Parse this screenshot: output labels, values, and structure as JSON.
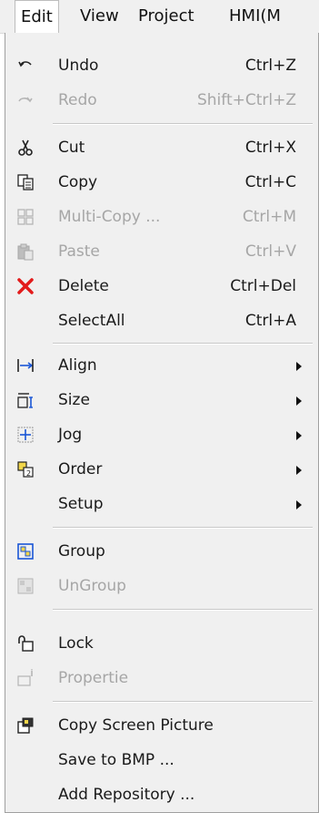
{
  "menubar": {
    "items": [
      "Edit",
      "View",
      "Project",
      "HMI(M"
    ]
  },
  "menu": {
    "undo": {
      "label": "Undo",
      "shortcut": "Ctrl+Z"
    },
    "redo": {
      "label": "Redo",
      "shortcut": "Shift+Ctrl+Z"
    },
    "cut": {
      "label": "Cut",
      "shortcut": "Ctrl+X"
    },
    "copy": {
      "label": "Copy",
      "shortcut": "Ctrl+C"
    },
    "multi_copy": {
      "label": "Multi-Copy ...",
      "shortcut": "Ctrl+M"
    },
    "paste": {
      "label": "Paste",
      "shortcut": "Ctrl+V"
    },
    "delete": {
      "label": "Delete",
      "shortcut": "Ctrl+Del"
    },
    "select_all": {
      "label": "SelectAll",
      "shortcut": "Ctrl+A"
    },
    "align": {
      "label": "Align"
    },
    "size": {
      "label": "Size"
    },
    "jog": {
      "label": "Jog"
    },
    "order": {
      "label": "Order"
    },
    "setup": {
      "label": "Setup"
    },
    "group": {
      "label": "Group"
    },
    "ungroup": {
      "label": "UnGroup"
    },
    "lock": {
      "label": "Lock"
    },
    "properties": {
      "label": "Propertie"
    },
    "copy_screen_picture": {
      "label": "Copy Screen Picture"
    },
    "save_to_bmp": {
      "label": "Save to BMP ..."
    },
    "add_repository": {
      "label": "Add Repository ..."
    }
  },
  "icons": {
    "undo": "undo-icon",
    "redo": "redo-icon",
    "cut": "scissors-icon",
    "copy": "copy-icon",
    "multi_copy": "multi-copy-icon",
    "paste": "paste-icon",
    "delete": "delete-x-icon",
    "align": "align-icon",
    "size": "size-icon",
    "jog": "jog-icon",
    "order": "order-icon",
    "group": "group-icon",
    "ungroup": "ungroup-icon",
    "lock": "lock-icon",
    "properties": "properties-icon",
    "copy_screen_picture": "screen-picture-icon"
  },
  "colors": {
    "menu_background": "#f0f0f0",
    "disabled_text": "#a6a6a6",
    "delete_icon": "#e31b1b",
    "group_icon": "#1a56d6"
  }
}
